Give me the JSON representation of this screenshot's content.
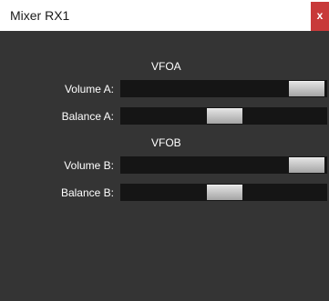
{
  "window": {
    "title": "Mixer RX1",
    "close_label": "x"
  },
  "sections": [
    {
      "title": "VFOA",
      "rows": [
        {
          "label": "Volume A:",
          "value": 1.0
        },
        {
          "label": "Balance A:",
          "value": 0.5
        }
      ]
    },
    {
      "title": "VFOB",
      "rows": [
        {
          "label": "Volume B:",
          "value": 1.0
        },
        {
          "label": "Balance B:",
          "value": 0.5
        }
      ]
    }
  ],
  "colors": {
    "background": "#343434",
    "track": "#151515",
    "close_button": "#c83a3a",
    "text": "#ffffff"
  }
}
